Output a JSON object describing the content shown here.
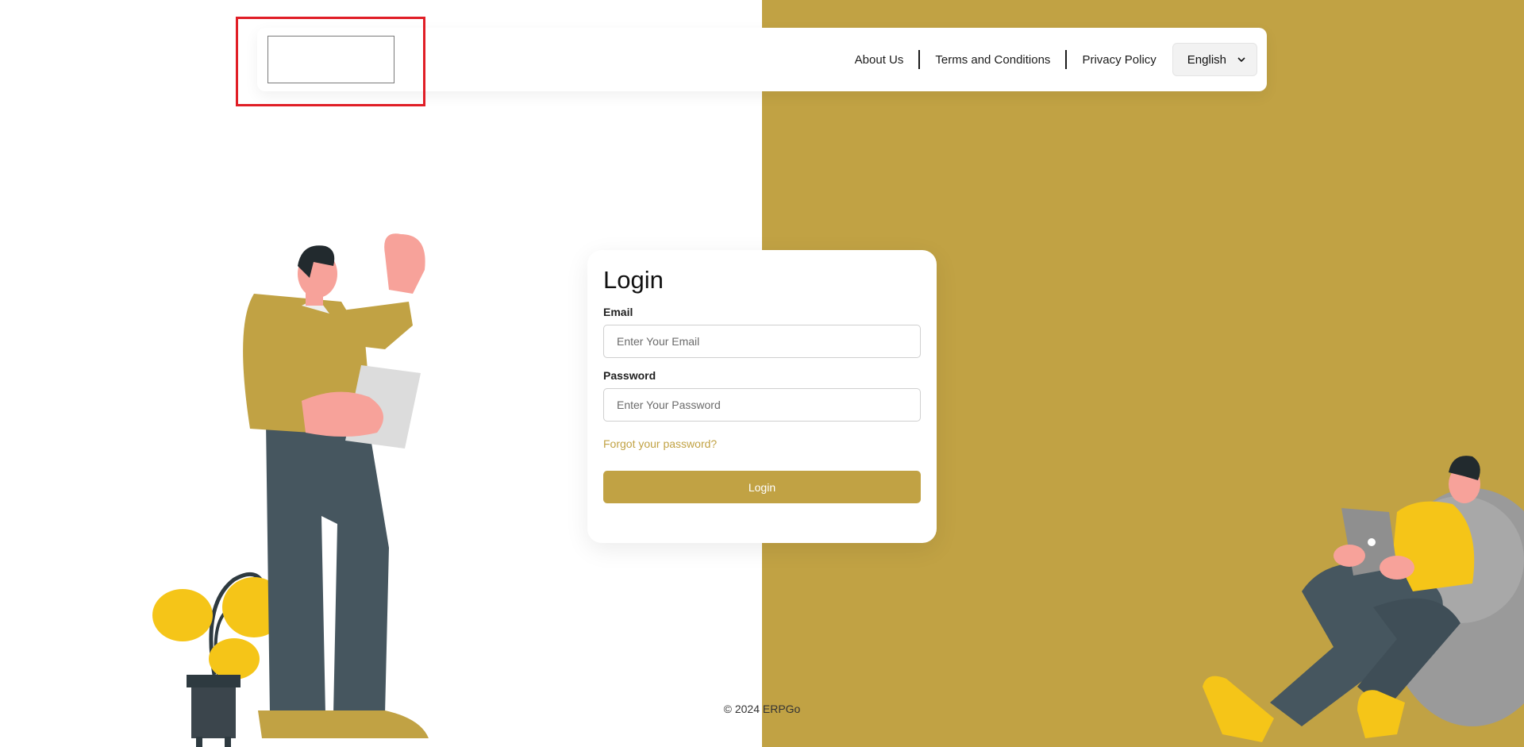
{
  "header": {
    "nav": [
      {
        "label": "About Us"
      },
      {
        "label": "Terms and Conditions"
      },
      {
        "label": "Privacy Policy"
      }
    ],
    "language": {
      "selected": "English"
    }
  },
  "login": {
    "title": "Login",
    "email_label": "Email",
    "email_placeholder": "Enter Your Email",
    "email_value": "",
    "password_label": "Password",
    "password_placeholder": "Enter Your Password",
    "password_value": "",
    "forgot_link": "Forgot your password?",
    "submit_label": "Login"
  },
  "footer": {
    "copyright": "© 2024 ERPGo"
  },
  "colors": {
    "accent": "#c1a244",
    "highlight": "#e01e26",
    "text": "#1b1b1b"
  },
  "icons": {
    "language_dropdown": "chevron-down-icon"
  }
}
